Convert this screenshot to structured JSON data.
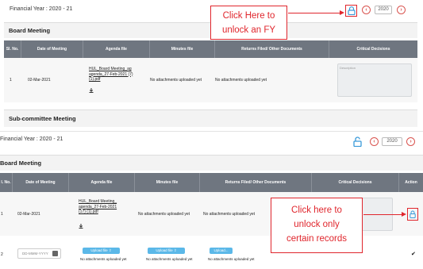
{
  "top": {
    "fy_label": "Financial Year : 2020 - 21",
    "year_value": "2020",
    "prev_glyph": "‹",
    "next_glyph": "›",
    "board_meeting_title": "Board Meeting",
    "headers": [
      "Sl. No.",
      "Date of Meeting",
      "Agenda file",
      "Minutes file",
      "Returns Filed/ Other Documents",
      "Critical Decisions"
    ],
    "row": {
      "sl": "1",
      "date": "02-Mar-2021",
      "agenda_lines": [
        "HUL_Board Meeting_ag",
        "agenda_27-Feb-2021 (7)",
        "(1).pdf"
      ],
      "minutes": "No attachments uploaded yet",
      "returns": "No attachments uploaded yet",
      "desc_placeholder": "Description"
    },
    "subcommittee_title": "Sub-committee Meeting"
  },
  "bottom": {
    "fy_label": "Financial Year : 2020 - 21",
    "year_value": "2020",
    "prev_glyph": "‹",
    "next_glyph": "›",
    "board_meeting_title": "Board Meeting",
    "headers": [
      "l. No.",
      "Date of Meeting",
      "Agenda file",
      "Minutes file",
      "Returns Filed/ Other Documents",
      "Critical Decisions",
      "Action"
    ],
    "row1": {
      "sl": "1",
      "date": "02-Mar-2021",
      "agenda_lines": [
        "HUL_Board Meeting_",
        "agenda_27-Feb-2021",
        "(17) (1).pdf"
      ],
      "minutes": "No attachments uploaded yet",
      "returns": "No attachments uploaded yet"
    },
    "row2": {
      "sl": "2",
      "date_placeholder": "DD-MMM-YYYY",
      "upload_label_1": "Upload file",
      "upload_label_2": "Upload file",
      "upload_label_3": "Upload...",
      "note_1": "No attachments uploaded yet",
      "note_2": "No attachments uploaded yet",
      "note_3": "No attachments uploaded yet",
      "action_glyph": "✔"
    }
  },
  "callouts": {
    "unlock_fy": [
      "Click Here to",
      "unlock an FY"
    ],
    "unlock_records": [
      "Click here to",
      "unlock only",
      "certain records"
    ]
  },
  "colors": {
    "annotation_red": "#e0262d",
    "lock_blue": "#3a9ad9",
    "header_gray": "#6f7680"
  },
  "icons": [
    "lock-icon",
    "unlock-icon",
    "download-icon",
    "calendar-icon",
    "upload-icon",
    "check-icon"
  ]
}
